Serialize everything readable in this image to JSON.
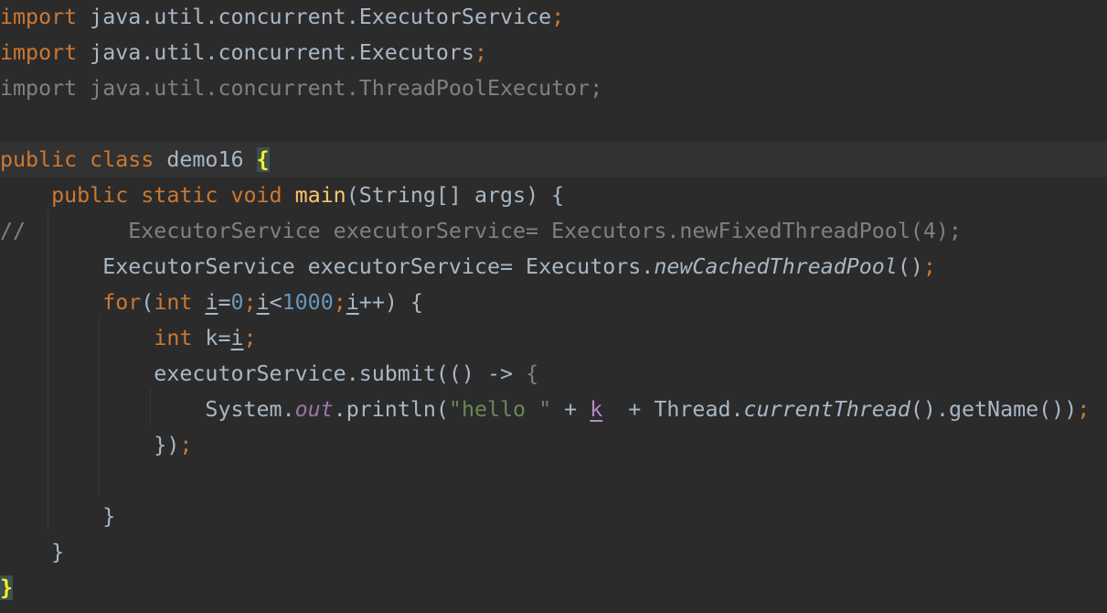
{
  "editor": {
    "theme": {
      "background": "#2b2b2b",
      "current_line": "#323232",
      "keyword": "#cc7832",
      "identifier": "#a9b7c6",
      "number": "#6897bb",
      "string": "#6a8759",
      "method_decl": "#ffc66d",
      "comment": "#808080",
      "static_field": "#9876aa",
      "captured_var": "#b389c5",
      "brace_match": "#ffef28"
    },
    "current_line_index": 4,
    "lines": [
      {
        "tokens": [
          {
            "t": "import",
            "c": "kw"
          },
          {
            "t": " java.util.concurrent.ExecutorService",
            "c": "id"
          },
          {
            "t": ";",
            "c": "kw"
          }
        ]
      },
      {
        "tokens": [
          {
            "t": "import",
            "c": "kw"
          },
          {
            "t": " java.util.concurrent.Executors",
            "c": "id"
          },
          {
            "t": ";",
            "c": "kw"
          }
        ]
      },
      {
        "tokens": [
          {
            "t": "import java.util.concurrent.ThreadPoolExecutor;",
            "c": "gray"
          }
        ]
      },
      {
        "tokens": []
      },
      {
        "tokens": [
          {
            "t": "public class ",
            "c": "kw"
          },
          {
            "t": "demo16 ",
            "c": "id"
          },
          {
            "t": "{",
            "c": "brace-hl"
          }
        ]
      },
      {
        "tokens": [
          {
            "t": "    public static void ",
            "c": "kw"
          },
          {
            "t": "main",
            "c": "fn"
          },
          {
            "t": "(String[] args) {",
            "c": "id"
          }
        ]
      },
      {
        "tokens": [
          {
            "t": "//        ExecutorService executorService= Executors.newFixedThreadPool(4);",
            "c": "gray"
          }
        ]
      },
      {
        "tokens": [
          {
            "t": "        ExecutorService executorService= Executors.",
            "c": "id"
          },
          {
            "t": "newCachedThreadPool",
            "c": "id ital"
          },
          {
            "t": "()",
            "c": "id"
          },
          {
            "t": ";",
            "c": "kw"
          }
        ]
      },
      {
        "tokens": [
          {
            "t": "        for",
            "c": "kw"
          },
          {
            "t": "(",
            "c": "id"
          },
          {
            "t": "int ",
            "c": "kw"
          },
          {
            "t": "i",
            "c": "id ul"
          },
          {
            "t": "=",
            "c": "id"
          },
          {
            "t": "0",
            "c": "num"
          },
          {
            "t": ";",
            "c": "kw"
          },
          {
            "t": "i",
            "c": "id ul"
          },
          {
            "t": "<",
            "c": "id"
          },
          {
            "t": "1000",
            "c": "num"
          },
          {
            "t": ";",
            "c": "kw"
          },
          {
            "t": "i",
            "c": "id ul"
          },
          {
            "t": "++) {",
            "c": "id"
          }
        ]
      },
      {
        "tokens": [
          {
            "t": "            int ",
            "c": "kw"
          },
          {
            "t": "k=",
            "c": "id"
          },
          {
            "t": "i",
            "c": "id ul"
          },
          {
            "t": ";",
            "c": "kw"
          }
        ]
      },
      {
        "tokens": [
          {
            "t": "            executorService.submit(() -> ",
            "c": "id"
          },
          {
            "t": "{",
            "c": "gray"
          }
        ]
      },
      {
        "tokens": [
          {
            "t": "                System.",
            "c": "id"
          },
          {
            "t": "out",
            "c": "static-fld"
          },
          {
            "t": ".println(",
            "c": "id"
          },
          {
            "t": "\"hello \"",
            "c": "str"
          },
          {
            "t": " + ",
            "c": "id"
          },
          {
            "t": "k",
            "c": "capt"
          },
          {
            "t": "  + Thread.",
            "c": "id"
          },
          {
            "t": "currentThread",
            "c": "id ital"
          },
          {
            "t": "().getName())",
            "c": "id"
          },
          {
            "t": ";",
            "c": "kw"
          }
        ]
      },
      {
        "tokens": [
          {
            "t": "            })",
            "c": "id"
          },
          {
            "t": ";",
            "c": "kw"
          }
        ]
      },
      {
        "tokens": []
      },
      {
        "tokens": [
          {
            "t": "        }",
            "c": "id"
          }
        ]
      },
      {
        "tokens": [
          {
            "t": "    }",
            "c": "id"
          }
        ]
      },
      {
        "tokens": [
          {
            "t": "}",
            "c": "brace-hl"
          }
        ]
      }
    ]
  }
}
